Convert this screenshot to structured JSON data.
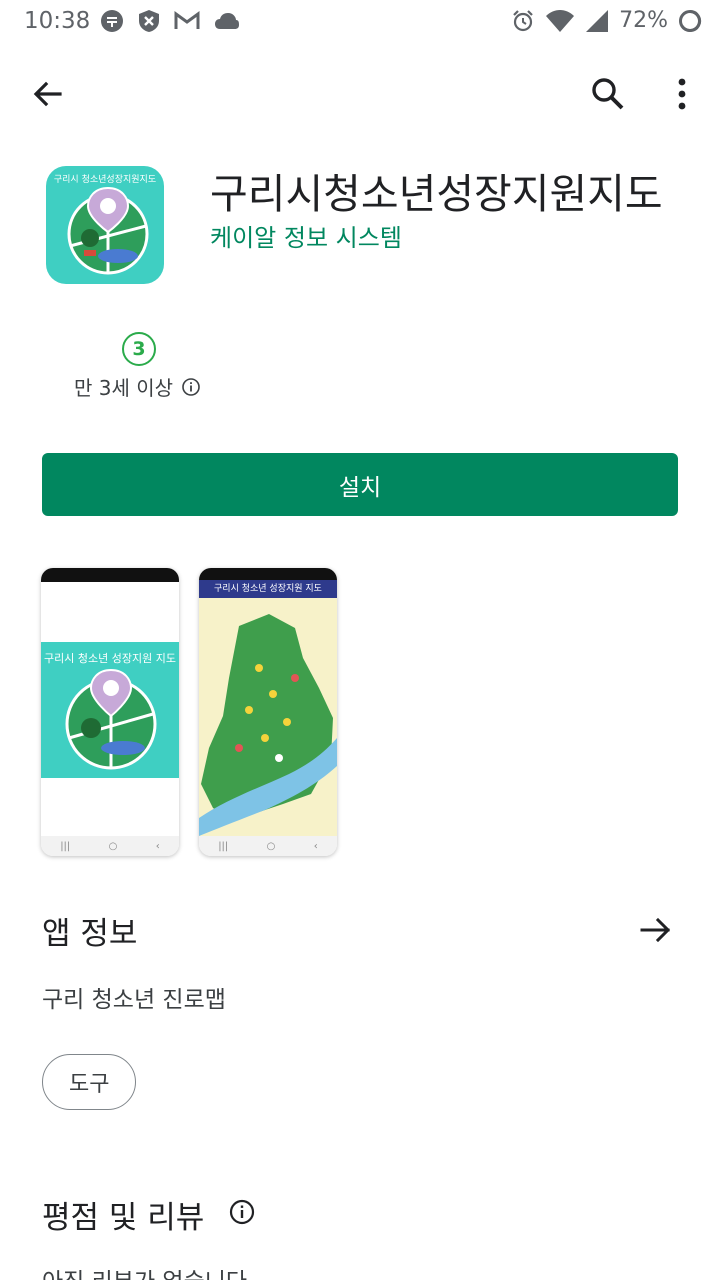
{
  "status_bar": {
    "time": "10:38",
    "battery": "72%",
    "icons": [
      "notification-icon",
      "shield-icon",
      "gmail-icon",
      "cloud-icon",
      "alarm-icon",
      "wifi-icon",
      "signal-icon",
      "battery-icon"
    ]
  },
  "app_bar": {
    "back_icon": "arrow-back-icon",
    "search_icon": "search-icon",
    "more_icon": "more-vert-icon"
  },
  "app": {
    "title": "구리시청소년성장지원지도",
    "developer": "케이알 정보 시스템",
    "icon_text": "구리시 청소년성장지원지도",
    "rating_badge": "3",
    "age_label": "만 3세 이상"
  },
  "install": {
    "label": "설치",
    "color": "#01875f"
  },
  "screenshots": {
    "shot1_title": "구리시 청소년 성장지원 지도",
    "shot2_title": "구리시 청소년 성장지원 지도"
  },
  "about": {
    "title": "앱 정보",
    "description": "구리 청소년 진로맵",
    "chip": "도구"
  },
  "ratings": {
    "title": "평점 및 리뷰",
    "empty": "아직 리뷰가 없습니다"
  }
}
